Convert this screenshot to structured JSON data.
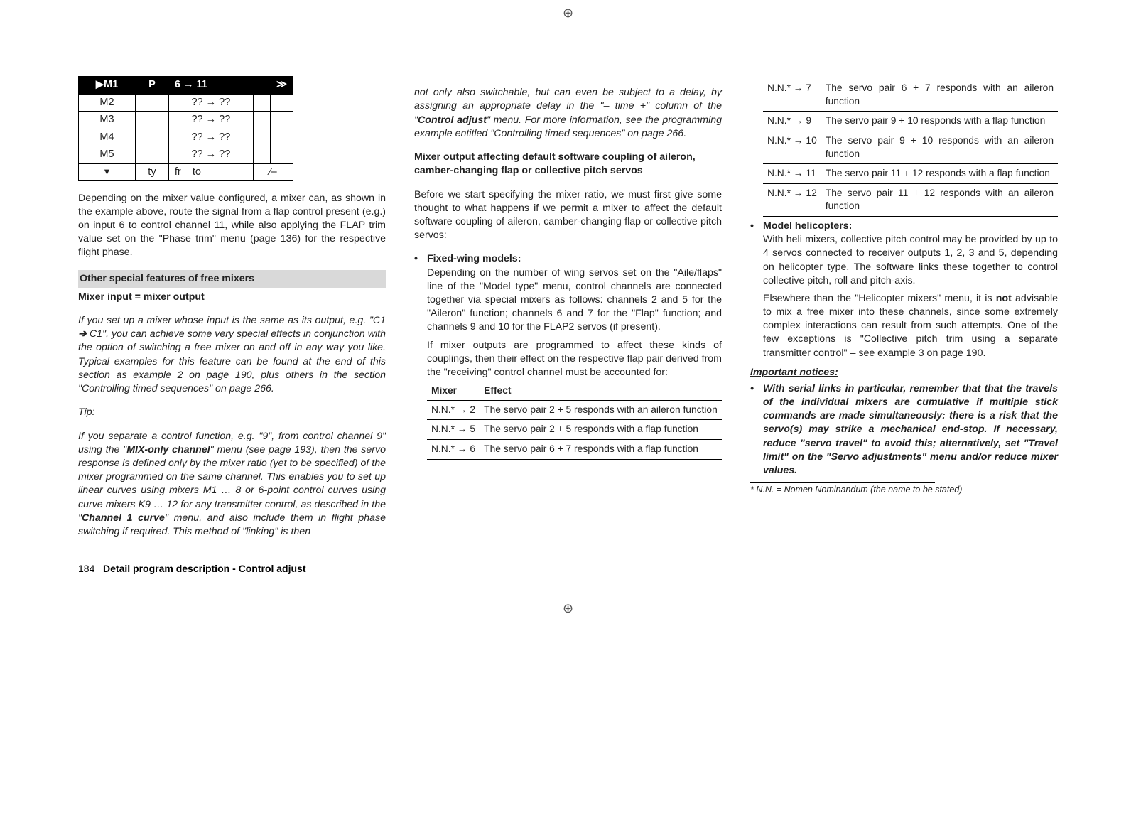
{
  "lcd": {
    "rowM1": {
      "c1": "▶M1",
      "p": "P",
      "chmap": "6 → 11",
      "sw": "≫"
    },
    "r2": {
      "c1": "M2",
      "chmap": "?? → ??"
    },
    "r3": {
      "c1": "M3",
      "chmap": "?? → ??"
    },
    "r4": {
      "c1": "M4",
      "chmap": "?? → ??"
    },
    "r5": {
      "c1": "M5",
      "chmap": "?? → ??"
    },
    "foot": {
      "a": "▾",
      "ty": "ty",
      "fr": "fr",
      "to": "to",
      "sw": "⁄–"
    }
  },
  "col1": {
    "p1": "Depending on the mixer value configured, a mixer can, as shown in the example above, route the signal from a flap control present (e.g.) on input 6 to control channel 11, while also applying the FLAP trim value set on the \"Phase trim\" menu (page 136) for the respective flight phase.",
    "bar1": "Other special features of free mixers",
    "h1": "Mixer input = mixer output",
    "p2a": "If you set up a mixer whose input is the same as its output, e.g. \"C1 ",
    "p2b": " C1\", you can achieve some very special effects in conjunction with the option of switching a free mixer on and off in any way you like. Typical examples for this feature can be found at the end of this section as example 2 on page 190, plus others in the section \"Controlling timed sequences\" on page 266.",
    "tip": "Tip:",
    "p3a": "If you separate a control function, e.g. \"9\", from control channel 9\" using the \"",
    "p3b": "MIX-only channel",
    "p3c": "\" menu (see page 193), then the servo response is defined only by the mixer ratio (yet to be specified) of the mixer programmed on the same channel. This enables you to set up linear curves using mixers M1 … 8 or 6-point control curves using curve mixers K9 … 12 for any transmitter control, as described in the \"",
    "p3d": "Channel 1 curve",
    "p3e": "\" menu, and also include them in flight phase switching if required. This method of \"linking\" is then"
  },
  "col2": {
    "p1a": "not only also switchable, but can even be subject to a delay, by assigning an appropriate delay in the \"– time +\" column of the \"",
    "p1b": "Control adjust",
    "p1c": "\" menu. For more information, see the programming example entitled \"Controlling timed sequences\" on page 266.",
    "h1": "Mixer output affecting default software coupling of aileron, camber-changing flap or collective pitch servos",
    "p2": "Before we start specifying the mixer ratio, we must first give some thought to what happens if we permit a mixer to affect the default software coupling of aileron, camber-changing flap or collective pitch servos:",
    "b1": "Fixed-wing models:",
    "b1p": "Depending on the number of wing servos set on the \"Aile/flaps\" line of the \"Model type\" menu, control channels are connected together via special mixers as follows: channels 2 and 5 for the \"Aileron\" function; channels 6 and 7 for the \"Flap\" function; and channels 9 and 10 for the FLAP2 servos (if present).",
    "b1q": "If mixer outputs are programmed to affect these kinds of couplings, then their effect on the respective flap pair derived from the \"receiving\" control channel must be accounted for:"
  },
  "tab2": {
    "h1": "Mixer",
    "h2": "Effect",
    "r1a": "N.N.* → 2",
    "r1b": "The servo pair 2 + 5 responds with an aileron function",
    "r2a": "N.N.* → 5",
    "r2b": "The servo pair 2 + 5 responds with a flap function",
    "r3a": "N.N.* → 6",
    "r3b": "The servo pair 6 + 7 responds with a flap function"
  },
  "tab3": {
    "r1a": "N.N.* → 7",
    "r1b": "The servo pair 6 + 7 responds with an aileron function",
    "r2a": "N.N.* → 9",
    "r2b": "The servo pair 9 + 10 responds with a flap function",
    "r3a": "N.N.* → 10",
    "r3b": "The servo pair 9 + 10 responds with an aileron function",
    "r4a": "N.N.* → 11",
    "r4b": "The servo pair 11 + 12 responds with a flap function",
    "r5a": "N.N.* → 12",
    "r5b": "The servo pair 11 + 12 responds with an aileron function"
  },
  "col3": {
    "b1": "Model helicopters:",
    "b1p": "With heli mixers, collective pitch control may be provided by up to 4 servos connected to receiver outputs 1, 2, 3 and 5, depending on helicopter type. The software links these together to control collective pitch, roll and pitch-axis.",
    "b1qA": "Elsewhere than the \"Helicopter mixers\" menu, it is ",
    "b1qB": "not",
    "b1qC": " advisable to mix a free mixer into these channels, since some extremely complex interactions can result from such attempts. One of the few exceptions is \"Collective pitch trim using a separate transmitter control\" – see example 3 on page 190.",
    "imp": "Important notices:",
    "ib": "With serial links in particular, remember that that the travels of the individual mixers are cumulative if multiple stick commands are made simultaneously: there is a risk that the servo(s) may strike a mechanical end-stop. If necessary, reduce \"servo travel\" to avoid this; alternatively, set \"Travel limit\" on the \"Servo adjustments\" menu and/or reduce mixer values."
  },
  "footer": {
    "fn": "*   N.N. = Nomen Nominandum (the name to be stated)",
    "pg": "184",
    "title": "Detail program description - Control adjust"
  }
}
